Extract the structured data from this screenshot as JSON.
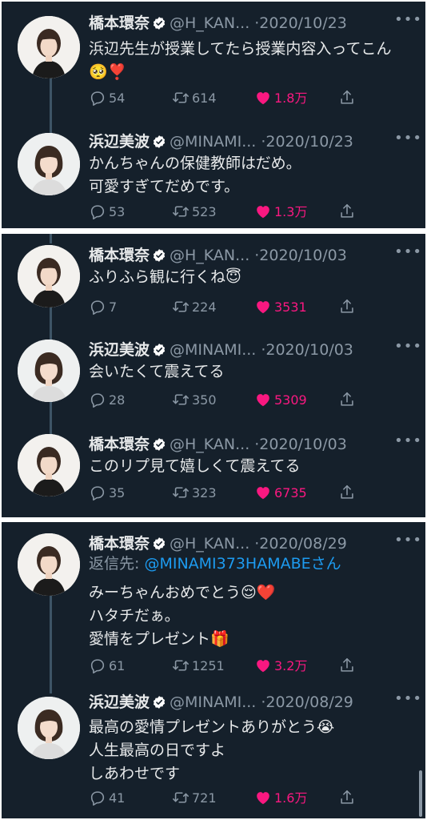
{
  "colors": {
    "background": "#15202b",
    "text": "#e7e9ea",
    "muted": "#8b98a5",
    "like": "#f91880",
    "link": "#1d9bf0",
    "verified": "#ffffff"
  },
  "icons": {
    "reply": "reply-icon",
    "retweet": "retweet-icon",
    "like": "heart-icon",
    "share": "share-icon",
    "verified": "verified-badge-icon",
    "more": "more-icon"
  },
  "panels": [
    {
      "tweets": [
        {
          "name": "橋本環奈",
          "handle": "@H_KAN...",
          "date": "·2020/10/23",
          "text": "浜辺先生が授業してたら授業内容入ってこん🥺❣️",
          "replies": "54",
          "retweets": "614",
          "likes": "1.8万"
        },
        {
          "name": "浜辺美波",
          "handle": "@MINAMI...",
          "date": "·2020/10/23",
          "text": "かんちゃんの保健教師はだめ。\n可愛すぎてだめです。",
          "replies": "53",
          "retweets": "523",
          "likes": "1.3万"
        }
      ]
    },
    {
      "tweets": [
        {
          "name": "橋本環奈",
          "handle": "@H_KAN...",
          "date": "·2020/10/03",
          "text": "ふりふら観に行くね😇",
          "replies": "7",
          "retweets": "224",
          "likes": "3531"
        },
        {
          "name": "浜辺美波",
          "handle": "@MINAMI...",
          "date": "·2020/10/03",
          "text": "会いたくて震えてる",
          "replies": "28",
          "retweets": "350",
          "likes": "5309"
        },
        {
          "name": "橋本環奈",
          "handle": "@H_KAN...",
          "date": "·2020/10/03",
          "text": "このリプ見て嬉しくて震えてる",
          "replies": "35",
          "retweets": "323",
          "likes": "6735"
        }
      ]
    },
    {
      "tweets": [
        {
          "name": "橋本環奈",
          "handle": "@H_KAN...",
          "date": "·2020/08/29",
          "reply_prefix": "返信先: ",
          "reply_mention": "@MINAMI373HAMABEさん",
          "text": "みーちゃんおめでとう😌❤️\nハタチだぁ。\n愛情をプレゼント🎁",
          "replies": "61",
          "retweets": "1251",
          "likes": "3.2万"
        },
        {
          "name": "浜辺美波",
          "handle": "@MINAMI...",
          "date": "·2020/08/29",
          "text": "最高の愛情プレゼントありがとう😭\n人生最高の日ですよ\nしあわせです",
          "replies": "41",
          "retweets": "721",
          "likes": "1.6万"
        }
      ]
    }
  ]
}
